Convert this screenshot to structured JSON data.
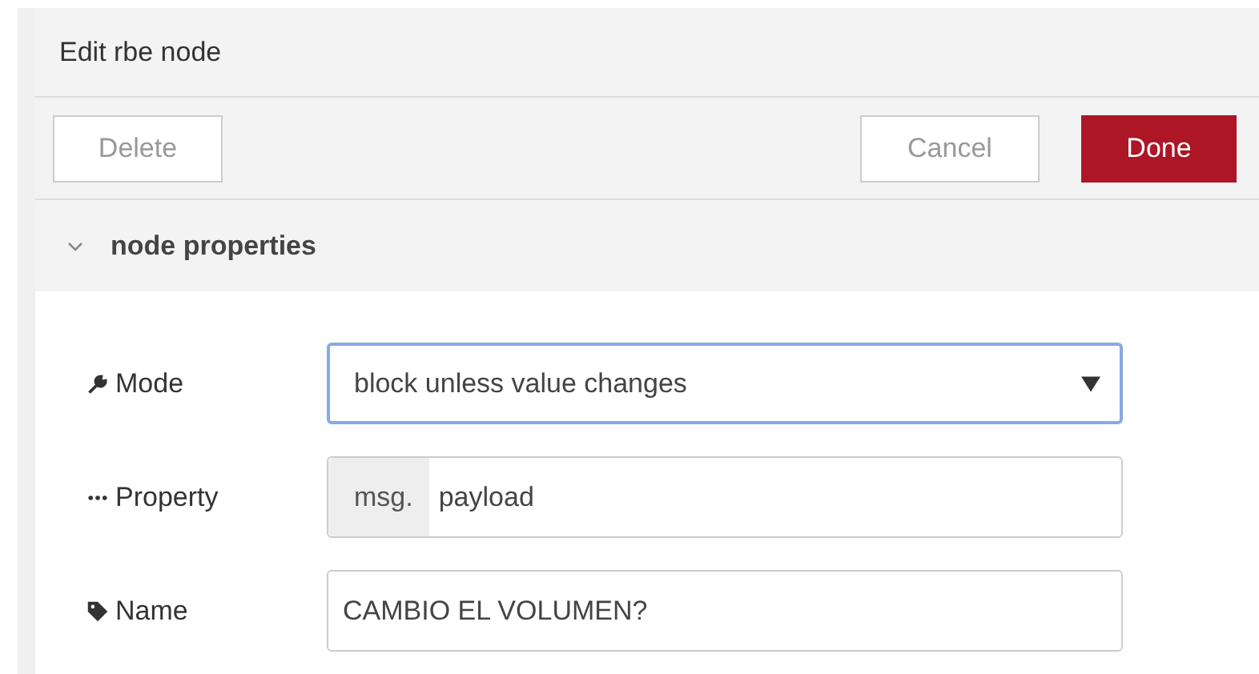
{
  "dialog": {
    "title": "Edit rbe node"
  },
  "buttons": [
    {
      "label": "Delete",
      "kind": "plain"
    },
    {
      "label": "Cancel",
      "kind": "plain"
    },
    {
      "label": "Done",
      "kind": "primary"
    }
  ],
  "section": {
    "title": "node properties",
    "expanded": true
  },
  "fields": [
    {
      "label": "Mode",
      "kind": "select",
      "value": "block unless value changes",
      "focused": true
    },
    {
      "label": "Property",
      "kind": "typed",
      "prefix": "msg.",
      "value": "payload",
      "focused": false
    },
    {
      "label": "Name",
      "kind": "text",
      "value": "CAMBIO EL VOLUMEN?",
      "focused": false
    }
  ]
}
